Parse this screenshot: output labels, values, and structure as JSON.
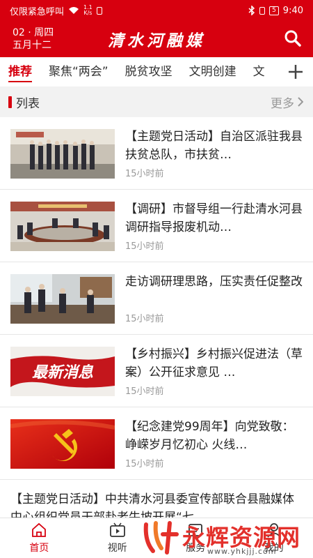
{
  "statusbar": {
    "carrier": "仅限紧急呼叫",
    "net_top": "1.1",
    "net_bottom": "K/s",
    "battery": "5",
    "time": "9:40"
  },
  "header": {
    "date_line1": "02 · 周四",
    "date_line2": "五月十二",
    "title": "清水河融媒",
    "colors": {
      "brand": "#d7000f"
    }
  },
  "tabs": [
    {
      "label": "推荐",
      "active": true
    },
    {
      "label": "聚焦“两会”"
    },
    {
      "label": "脱贫攻坚"
    },
    {
      "label": "文明创建"
    },
    {
      "label": "文"
    }
  ],
  "section": {
    "title": "列表",
    "more": "更多"
  },
  "items": [
    {
      "title": "【主题党日活动】自治区派驻我县扶贫总队，市扶贫…",
      "time": "15小时前",
      "thumb": "group-photo"
    },
    {
      "title": "【调研】市督导组一行赴清水河县调研指导报废机动…",
      "time": "15小时前",
      "thumb": "meeting-room"
    },
    {
      "title": "走访调研理思路，压实责任促整改",
      "time": "15小时前",
      "thumb": "office-visit"
    },
    {
      "title": "【乡村振兴】乡村振兴促进法（草案）公开征求意见 …",
      "time": "15小时前",
      "thumb": "news-banner",
      "thumb_text": "最新消息"
    },
    {
      "title": "【纪念建党99周年】向党致敬：峥嵘岁月忆初心 火线…",
      "time": "15小时前",
      "thumb": "party-flag"
    },
    {
      "title": "【主题党日活动】中共清水河县委宣传部联合县融媒体中心组织党员干部赴老牛坡开展“七…"
    }
  ],
  "bottomnav": [
    {
      "label": "首页",
      "icon": "home-icon",
      "active": true
    },
    {
      "label": "视听",
      "icon": "video-icon"
    },
    {
      "label": "服务",
      "icon": "service-icon"
    },
    {
      "label": "我的",
      "icon": "user-icon"
    }
  ],
  "watermark": {
    "text": "永辉资源网",
    "url": "www.yhkjjj.com"
  }
}
